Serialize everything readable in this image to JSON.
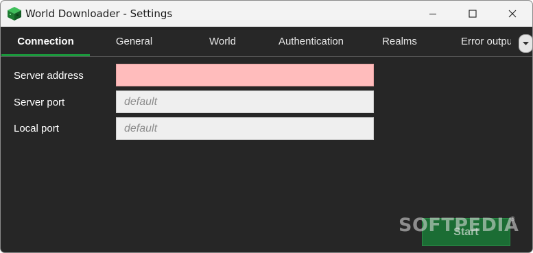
{
  "window": {
    "title": "World Downloader - Settings",
    "icon": "minecraft-block-icon",
    "controls": [
      "minimize-icon",
      "maximize-icon",
      "close-icon"
    ]
  },
  "tabs": [
    {
      "label": "Connection",
      "active": true
    },
    {
      "label": "General",
      "active": false
    },
    {
      "label": "World",
      "active": false
    },
    {
      "label": "Authentication",
      "active": false
    },
    {
      "label": "Realms",
      "active": false
    },
    {
      "label": "Error outpu",
      "active": false
    }
  ],
  "tab_scroll_icon": "chevron-down-icon",
  "form": {
    "server_address": {
      "label": "Server address",
      "value": "",
      "placeholder": "",
      "state": "error"
    },
    "server_port": {
      "label": "Server port",
      "value": "",
      "placeholder": "default"
    },
    "local_port": {
      "label": "Local port",
      "value": "",
      "placeholder": "default"
    }
  },
  "start_button": {
    "label": "Start"
  },
  "watermark": {
    "text": "SOFTPEDIA",
    "mark": "®"
  },
  "colors": {
    "accent": "#1a9a3c",
    "background": "#262626",
    "error_field": "#ffbcbc",
    "start_button": "#1b6d34"
  }
}
